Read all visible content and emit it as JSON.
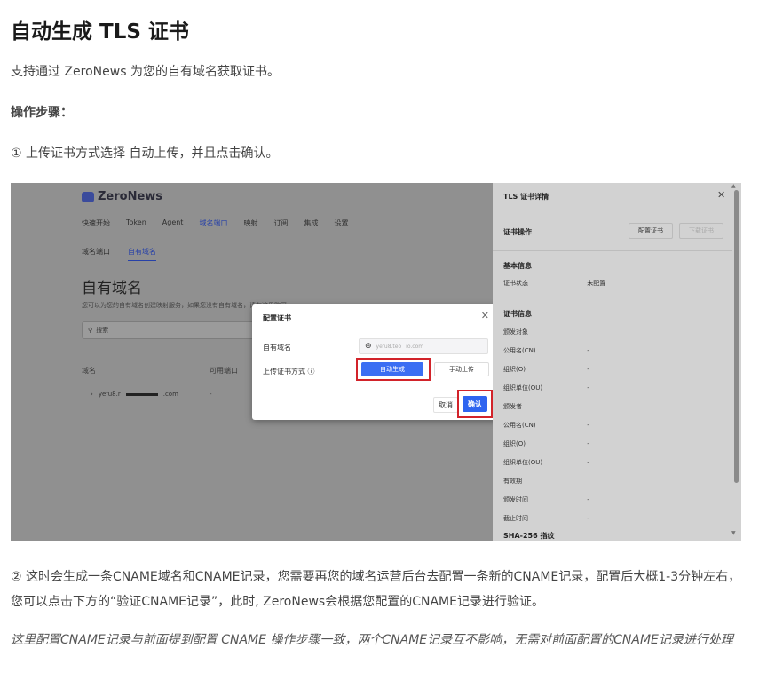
{
  "doc": {
    "title": "自动生成 TLS 证书",
    "intro": "支持通过 ZeroNews 为您的自有域名获取证书。",
    "steps_heading": "操作步骤：",
    "step1": "① 上传证书方式选择 自动上传，并且点击确认。",
    "step2": "② 这时会生成一条CNAME域名和CNAME记录，您需要再您的域名运营后台去配置一条新的CNAME记录，配置后大概1-3分钟左右，您可以点击下方的“验证CNAME记录”，此时, ZeroNews会根据您配置的CNAME记录进行验证。",
    "note": "这里配置CNAME记录与前面提到配置 CNAME 操作步骤一致，两个CNAME记录互不影响，无需对前面配置的CNAME记录进行处理"
  },
  "screenshot": {
    "app": {
      "logo": "ZeroNews",
      "nav": [
        "快速开始",
        "Token",
        "Agent",
        "域名端口",
        "映射",
        "订阅",
        "集成",
        "设置"
      ],
      "nav_active_index": 3,
      "subtabs": [
        "域名端口",
        "自有域名"
      ],
      "subtab_active_index": 1,
      "page_title": "自有域名",
      "page_subtitle": "您可以为您的自有域名创建映射服务，如果您没有自有域名，请在这里购买",
      "search_placeholder": "搜索",
      "table_headers": [
        "域名",
        "可用端口"
      ],
      "row_domain_prefix": "yefu8.r",
      "row_domain_suffix": ".com",
      "row_port": "-"
    },
    "modal": {
      "title": "配置证书",
      "domain_label": "自有域名",
      "domain_value_prefix": "yefu8.teo",
      "domain_value_suffix": "io.com",
      "upload_label": "上传证书方式",
      "auto_label": "自动生成",
      "manual_label": "手动上传",
      "cancel_label": "取消",
      "confirm_label": "确认"
    },
    "drawer": {
      "title": "TLS 证书详情",
      "ops_label": "证书操作",
      "config_btn": "配置证书",
      "download_btn": "下载证书",
      "basic_info": "基本信息",
      "status_key": "证书状态",
      "status_val": "未配置",
      "cert_info": "证书信息",
      "issued_to": "颁发对象",
      "cn_key": "公用名(CN)",
      "o_key": "组织(O)",
      "ou_key": "组织单位(OU)",
      "issuer": "颁发者",
      "issuer_cn_key": "公用名(CN)",
      "issuer_o_key": "组织(O)",
      "issuer_ou_key": "组织单位(OU)",
      "validity": "有效期",
      "issued_time_key": "颁发时间",
      "expiry_key": "截止时间",
      "sha_label": "SHA-256 指纹",
      "dash": "-"
    }
  }
}
